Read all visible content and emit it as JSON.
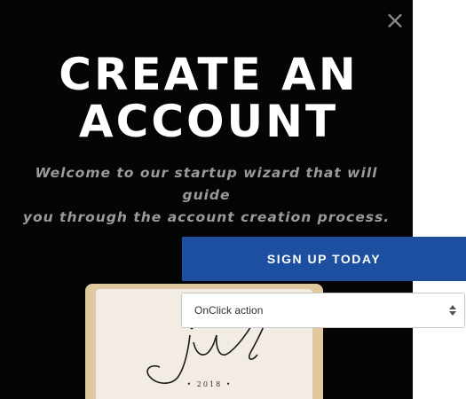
{
  "modal": {
    "headline_line1": "CREATE AN",
    "headline_line2": "ACCOUNT",
    "subtitle_line1": "Welcome to our startup wizard that will guide",
    "subtitle_line2": "you through the account creation process.",
    "close_icon": "close-icon",
    "image": {
      "script_text": "jul",
      "year_text": "• 2018 •"
    }
  },
  "signup_button": {
    "label": "SIGN UP TODAY",
    "color": "#1c4fa0"
  },
  "action_select": {
    "selected": "OnClick action",
    "icon": "sort-arrows-icon"
  },
  "colors": {
    "panel_background": "#050505",
    "headline": "#ffffff",
    "subtitle": "#9a9a9a"
  }
}
